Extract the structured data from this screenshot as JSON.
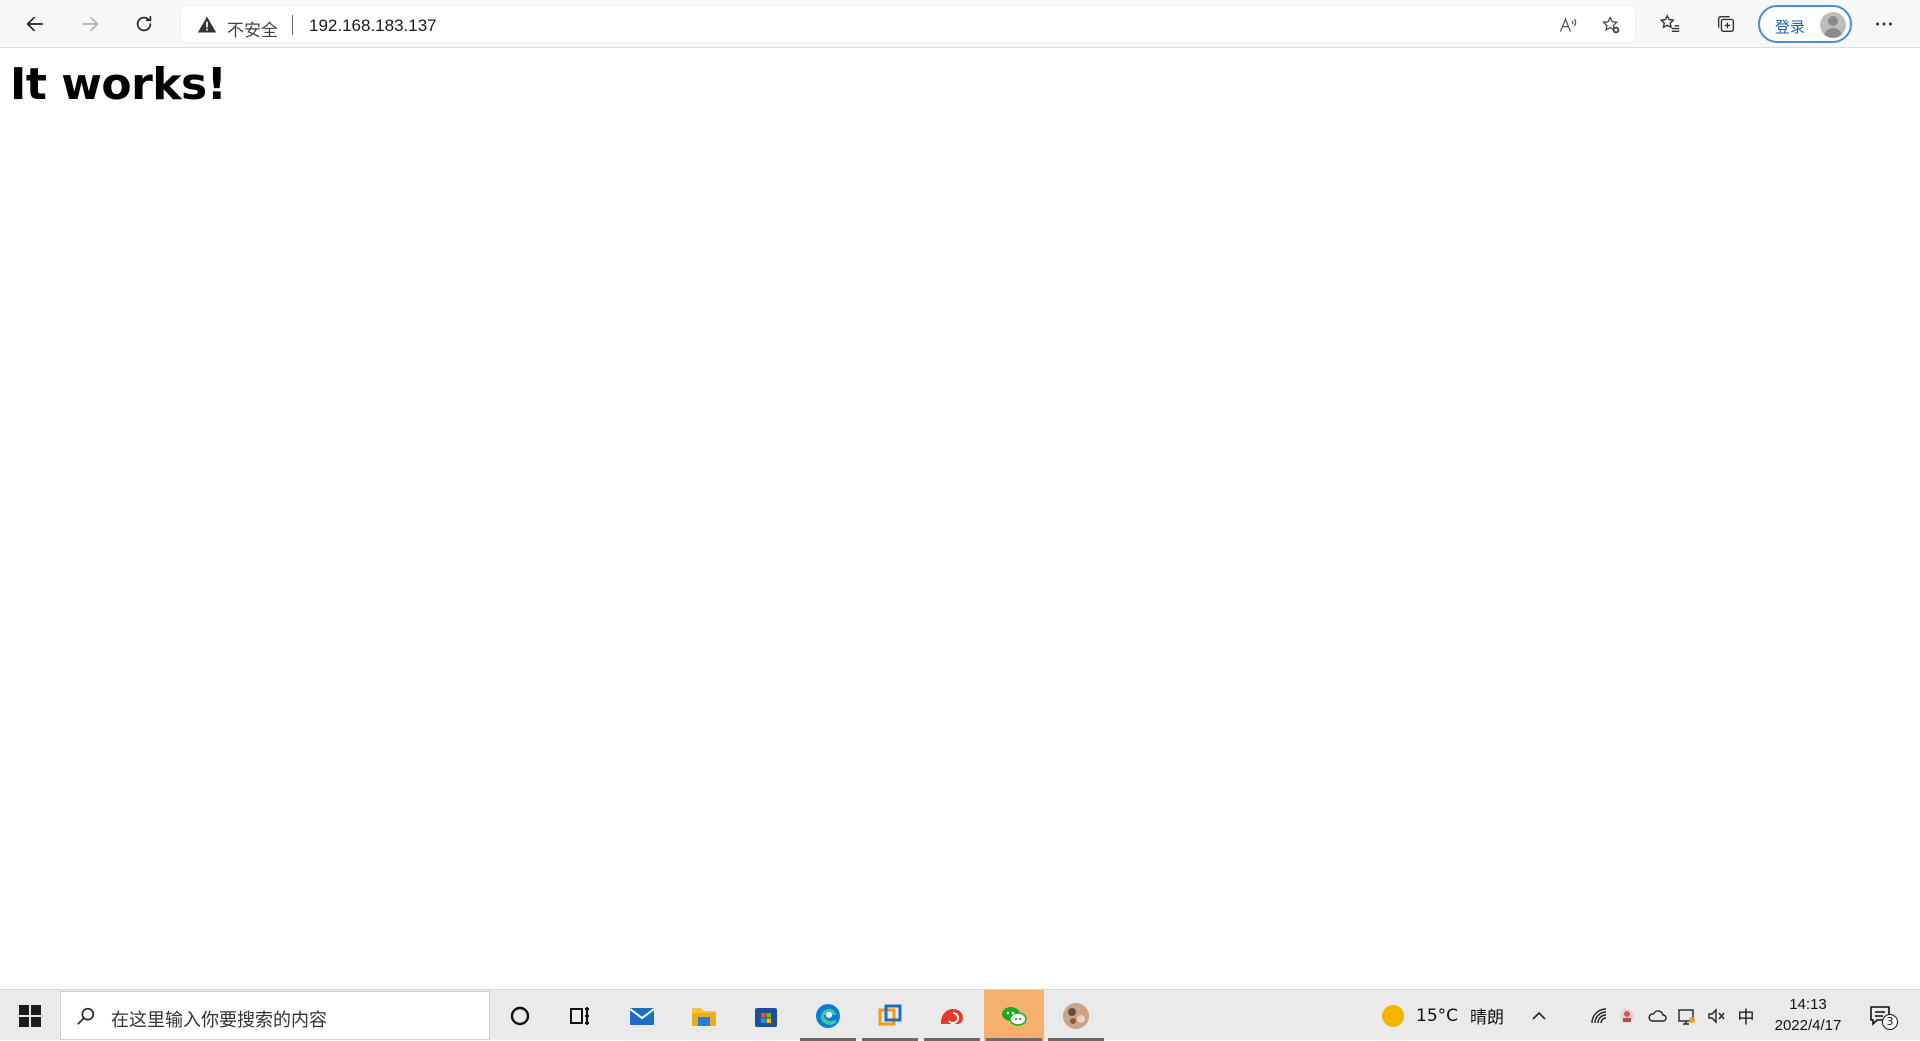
{
  "browser": {
    "security_label": "不安全",
    "url": "192.168.183.137",
    "login_label": "登录"
  },
  "page": {
    "heading": "It works!"
  },
  "taskbar": {
    "search_placeholder": "在这里输入你要搜索的内容",
    "weather_temp": "15°C",
    "weather_desc": "晴朗",
    "ime": "中",
    "time": "14:13",
    "date": "2022/4/17",
    "notification_count": "3"
  },
  "icons": {
    "back": "back-arrow-icon",
    "forward": "forward-arrow-icon",
    "refresh": "refresh-icon",
    "warning": "warning-icon",
    "read_aloud": "read-aloud-icon",
    "add_favorite": "add-favorite-icon",
    "favorites": "favorites-icon",
    "collections": "collections-icon",
    "more": "more-icon"
  },
  "colors": {
    "accent": "#1c5eb8",
    "taskbar_bg": "#eaeaea",
    "highlight": "#f5b06e"
  }
}
